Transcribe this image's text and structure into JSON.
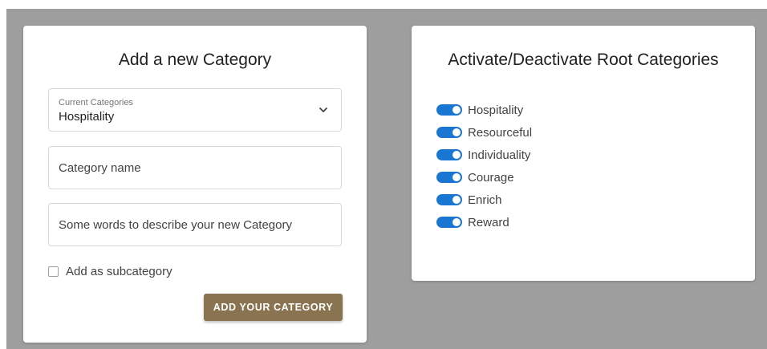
{
  "add_card": {
    "title": "Add a new Category",
    "select": {
      "caption": "Current Categories",
      "value": "Hospitality",
      "icon": "chevron-down-icon"
    },
    "name_field": {
      "placeholder": "Category name",
      "value": ""
    },
    "description_field": {
      "placeholder": "Some words to describe your new Category",
      "value": ""
    },
    "subcategory_checkbox": {
      "label": "Add as subcategory",
      "checked": false
    },
    "submit_label": "ADD YOUR CATEGORY",
    "button_color": "#8a7350"
  },
  "root_card": {
    "title": "Activate/Deactivate Root Categories",
    "toggle_color": "#1976d2",
    "categories": [
      {
        "label": "Hospitality",
        "active": true
      },
      {
        "label": "Resourceful",
        "active": true
      },
      {
        "label": "Individuality",
        "active": true
      },
      {
        "label": "Courage",
        "active": true
      },
      {
        "label": "Enrich",
        "active": true
      },
      {
        "label": "Reward",
        "active": true
      }
    ]
  }
}
